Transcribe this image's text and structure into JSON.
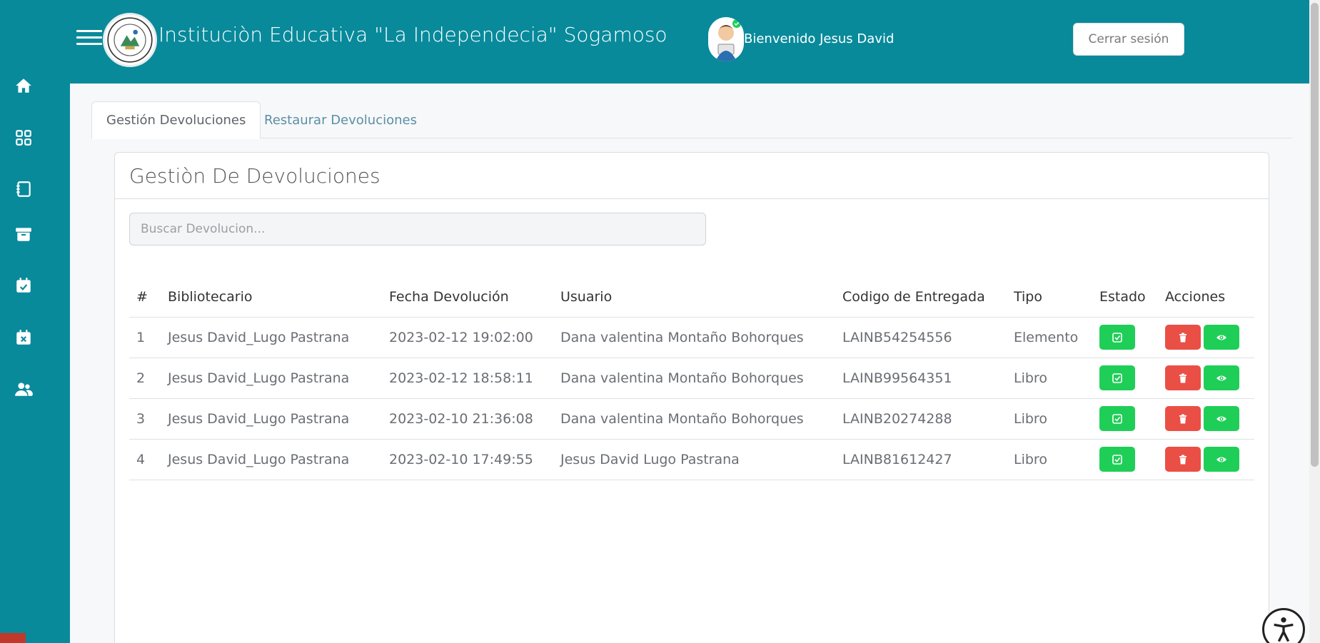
{
  "header": {
    "title": "Instituciòn Educativa \"La Independecia\" Sogamoso",
    "welcome": "Bienvenido Jesus David",
    "logout_label": "Cerrar sesión"
  },
  "sidebar": {
    "items": [
      {
        "icon": "home-icon"
      },
      {
        "icon": "grid-icon"
      },
      {
        "icon": "notebook-icon"
      },
      {
        "icon": "archive-icon"
      },
      {
        "icon": "calendar-check-icon"
      },
      {
        "icon": "calendar-x-icon"
      },
      {
        "icon": "users-icon"
      }
    ]
  },
  "tabs": [
    {
      "label": "Gestión Devoluciones",
      "active": true
    },
    {
      "label": "Restaurar Devoluciones",
      "active": false
    }
  ],
  "card": {
    "title": "Gestiòn De Devoluciones",
    "search_placeholder": "Buscar Devolucion..."
  },
  "table": {
    "headers": [
      "#",
      "Bibliotecario",
      "Fecha Devolución",
      "Usuario",
      "Codigo de Entregada",
      "Tipo",
      "Estado",
      "Acciones"
    ],
    "rows": [
      {
        "num": "1",
        "bibliotecario": "Jesus David_Lugo Pastrana",
        "fecha": "2023-02-12 19:02:00",
        "usuario": "Dana valentina Montaño Bohorques",
        "codigo": "LAINB54254556",
        "tipo": "Elemento"
      },
      {
        "num": "2",
        "bibliotecario": "Jesus David_Lugo Pastrana",
        "fecha": "2023-02-12 18:58:11",
        "usuario": "Dana valentina Montaño Bohorques",
        "codigo": "LAINB99564351",
        "tipo": "Libro"
      },
      {
        "num": "3",
        "bibliotecario": "Jesus David_Lugo Pastrana",
        "fecha": "2023-02-10 21:36:08",
        "usuario": "Dana valentina Montaño Bohorques",
        "codigo": "LAINB20274288",
        "tipo": "Libro"
      },
      {
        "num": "4",
        "bibliotecario": "Jesus David_Lugo Pastrana",
        "fecha": "2023-02-10 17:49:55",
        "usuario": "Jesus David Lugo Pastrana",
        "codigo": "LAINB81612427",
        "tipo": "Libro"
      }
    ]
  },
  "colors": {
    "primary": "#088a9b",
    "success": "#1fce57",
    "danger": "#ea4f46"
  }
}
